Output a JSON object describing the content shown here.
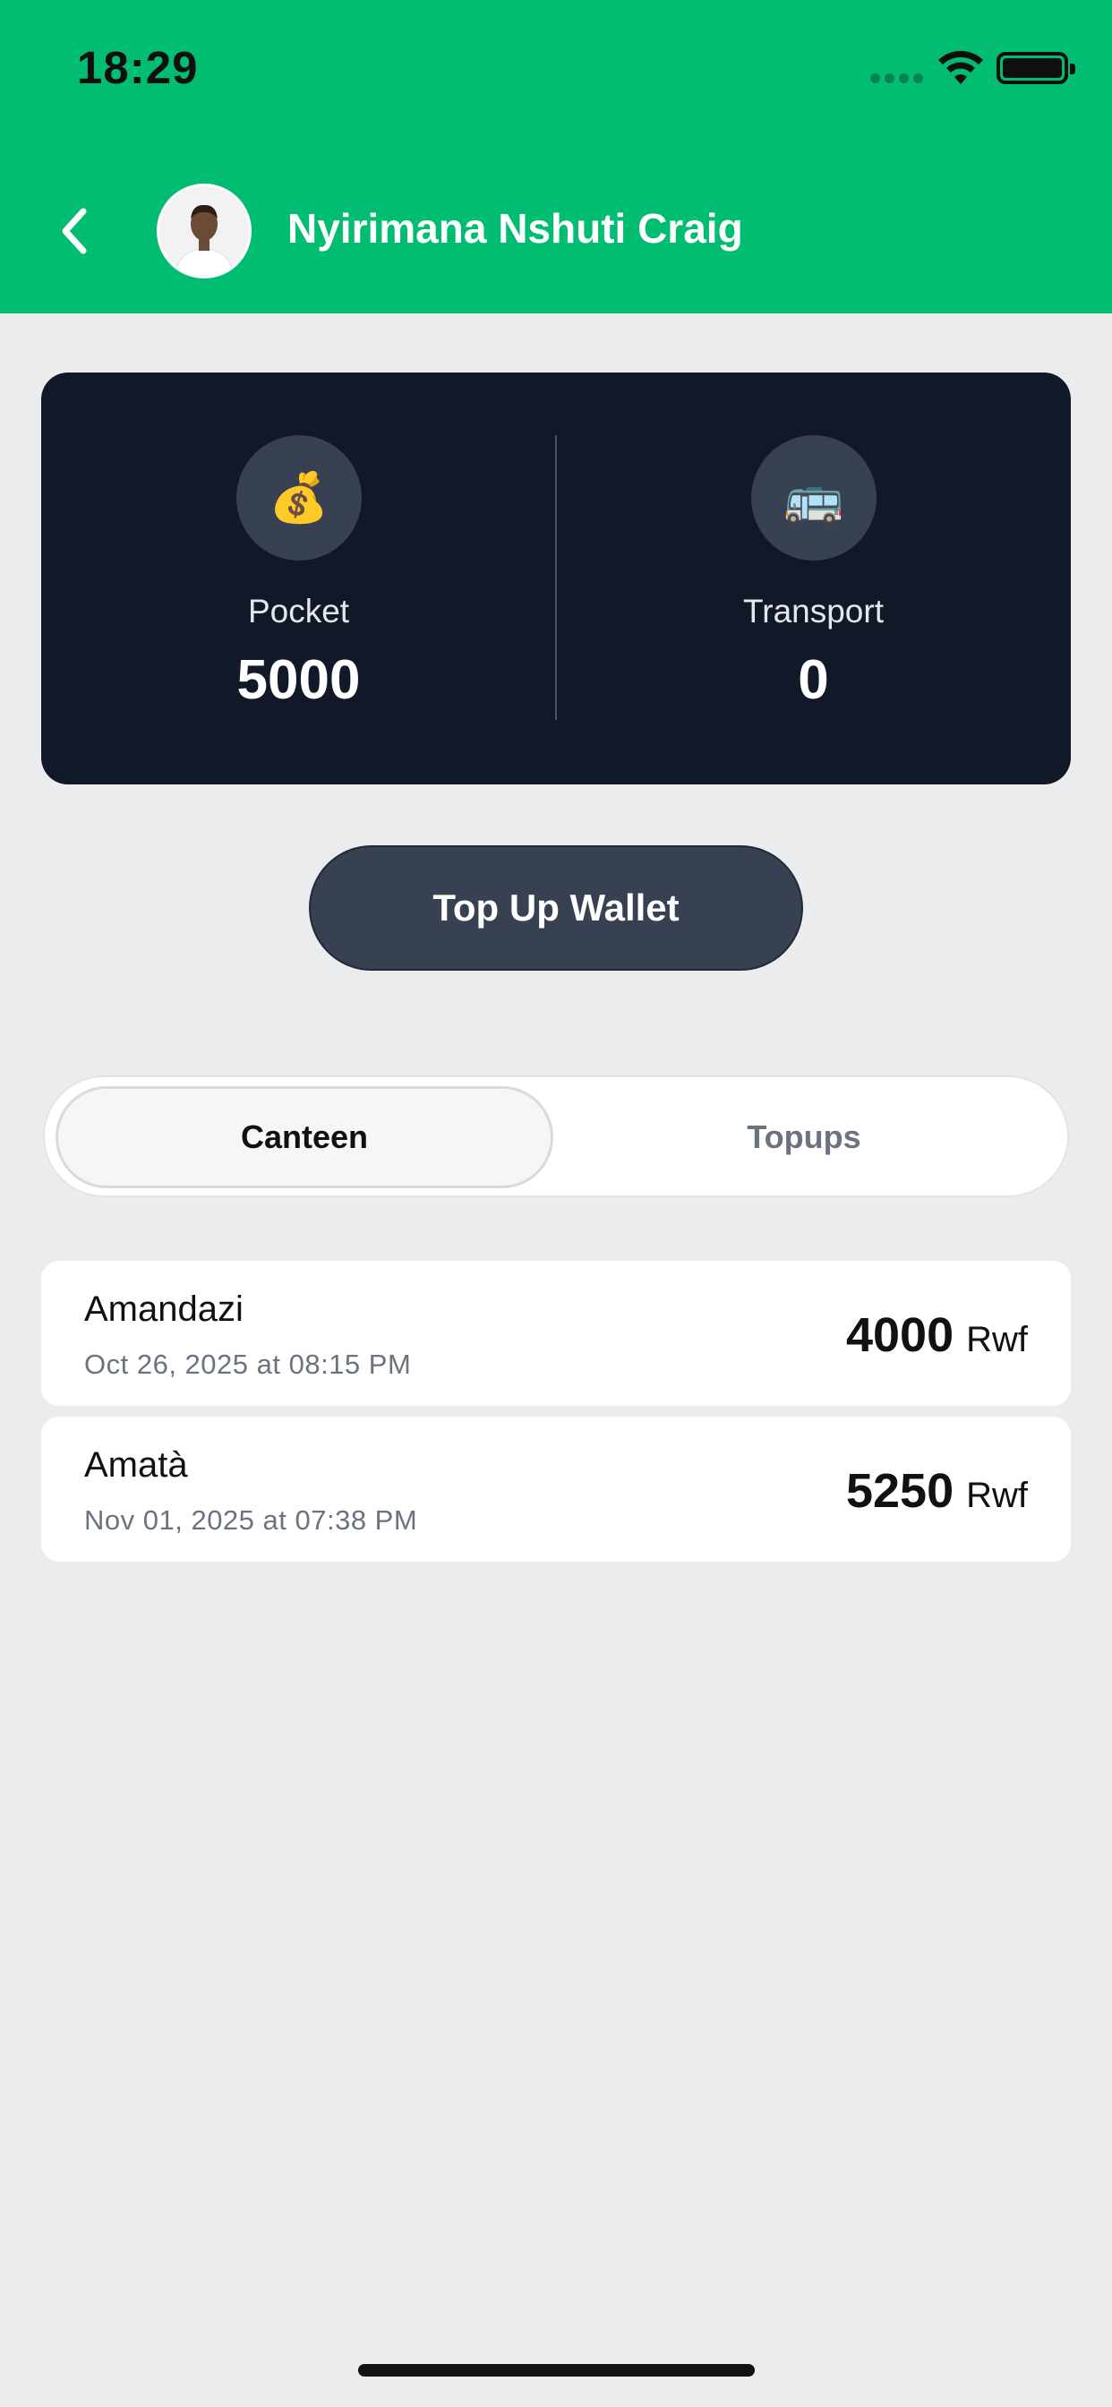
{
  "status_bar": {
    "time": "18:29"
  },
  "header": {
    "title": "Nyirimana Nshuti Craig",
    "back_icon": "chevron-left-icon",
    "avatar": "avatar"
  },
  "balances": {
    "pocket": {
      "icon": "💰",
      "label": "Pocket",
      "value": "5000"
    },
    "transport": {
      "icon": "🚌",
      "label": "Transport",
      "value": "0"
    }
  },
  "topup_button": {
    "label": "Top Up Wallet"
  },
  "tabs": [
    {
      "label": "Canteen",
      "active": true
    },
    {
      "label": "Topups",
      "active": false
    }
  ],
  "transactions": [
    {
      "name": "Amandazi",
      "date": "Oct 26, 2025 at 08:15 PM",
      "amount": "4000",
      "unit": "Rwf"
    },
    {
      "name": "Amatà",
      "date": "Nov 01, 2025 at 07:38 PM",
      "amount": "5250",
      "unit": "Rwf"
    }
  ],
  "colors": {
    "header_green": "#00bd72",
    "card_dark": "#111827",
    "button_dark": "#374151",
    "background": "#ebecee"
  }
}
